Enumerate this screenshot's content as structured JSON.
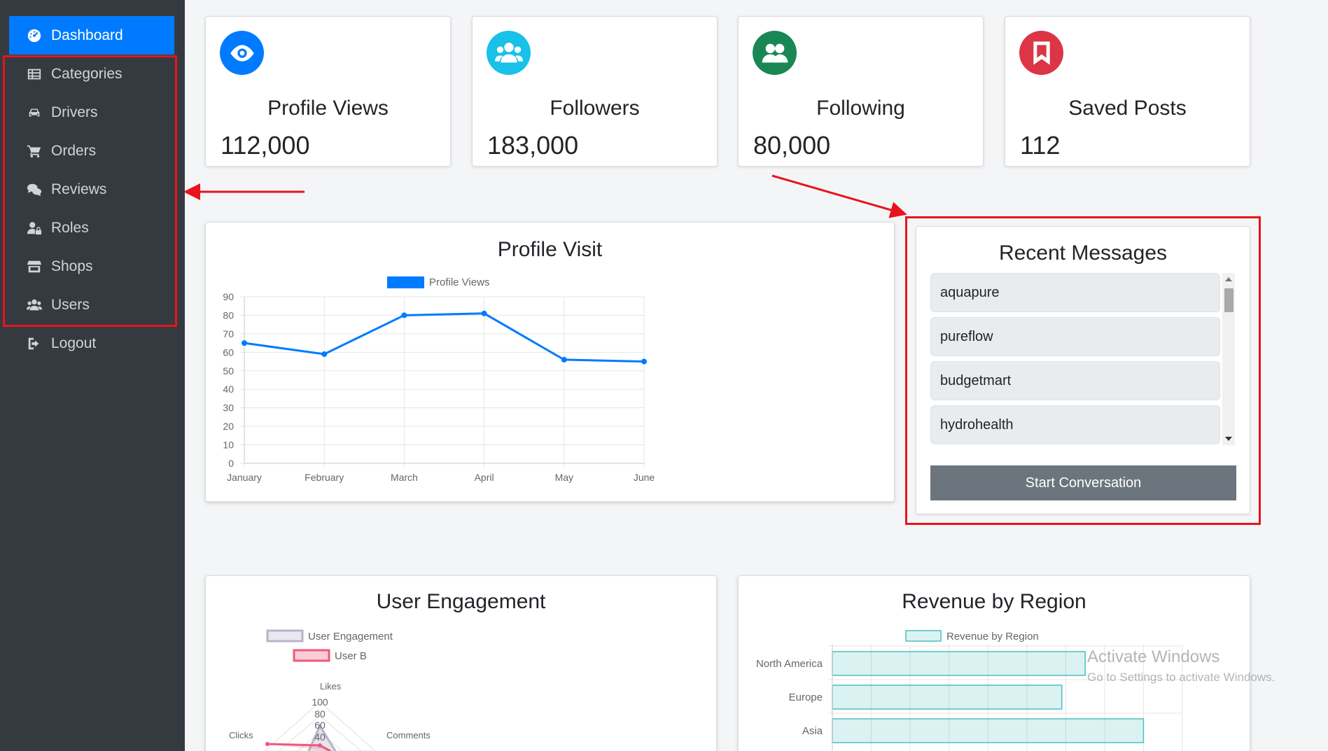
{
  "sidebar": {
    "items": [
      {
        "label": "Dashboard",
        "icon": "tachometer-icon",
        "active": true
      },
      {
        "label": "Categories",
        "icon": "table-list-icon"
      },
      {
        "label": "Drivers",
        "icon": "car-icon"
      },
      {
        "label": "Orders",
        "icon": "cart-icon"
      },
      {
        "label": "Reviews",
        "icon": "comments-icon"
      },
      {
        "label": "Roles",
        "icon": "user-lock-icon"
      },
      {
        "label": "Shops",
        "icon": "store-icon"
      },
      {
        "label": "Users",
        "icon": "users-icon"
      },
      {
        "label": "Logout",
        "icon": "sign-out-icon"
      }
    ]
  },
  "stats": [
    {
      "label": "Profile Views",
      "value": "112,000",
      "icon": "eye-icon",
      "color": "#007bff"
    },
    {
      "label": "Followers",
      "value": "183,000",
      "icon": "users-icon",
      "color": "#17c1e8"
    },
    {
      "label": "Following",
      "value": "80,000",
      "icon": "user-group-icon",
      "color": "#198754"
    },
    {
      "label": "Saved Posts",
      "value": "112",
      "icon": "bookmark-icon",
      "color": "#dc3545"
    }
  ],
  "profile_visit": {
    "title": "Profile Visit",
    "chart_data": {
      "type": "line",
      "categories": [
        "January",
        "February",
        "March",
        "April",
        "May",
        "June"
      ],
      "series": [
        {
          "name": "Profile Views",
          "values": [
            65,
            59,
            80,
            81,
            56,
            55
          ],
          "color": "#007bff"
        }
      ],
      "ylim": [
        0,
        90
      ],
      "yticks": [
        "90",
        "80",
        "70",
        "60",
        "50",
        "40",
        "30",
        "20",
        "10",
        "0"
      ],
      "grid": true,
      "legend": "top"
    }
  },
  "messages": {
    "title": "Recent Messages",
    "items": [
      "aquapure",
      "pureflow",
      "budgetmart",
      "hydrohealth"
    ],
    "button_label": "Start Conversation"
  },
  "engagement": {
    "title": "User Engagement",
    "chart_data": {
      "type": "radar",
      "categories": [
        "Likes",
        "Comments",
        "Clicks"
      ],
      "series": [
        {
          "name": "User Engagement",
          "color": "#b8b3c9"
        },
        {
          "name": "User B",
          "color": "#f0577d"
        }
      ],
      "ticks": [
        "100",
        "80",
        "60",
        "40"
      ]
    }
  },
  "revenue": {
    "title": "Revenue by Region",
    "chart_data": {
      "type": "bar",
      "orientation": "horizontal",
      "categories": [
        "North America",
        "Europe",
        "Asia"
      ],
      "series": [
        {
          "name": "Revenue by Region",
          "values": [
            65,
            59,
            80
          ],
          "color": "#4bc0c0"
        }
      ],
      "xlim": [
        0,
        90
      ]
    }
  },
  "watermark": {
    "line1": "Activate Windows",
    "line2": "Go to Settings to activate Windows."
  }
}
